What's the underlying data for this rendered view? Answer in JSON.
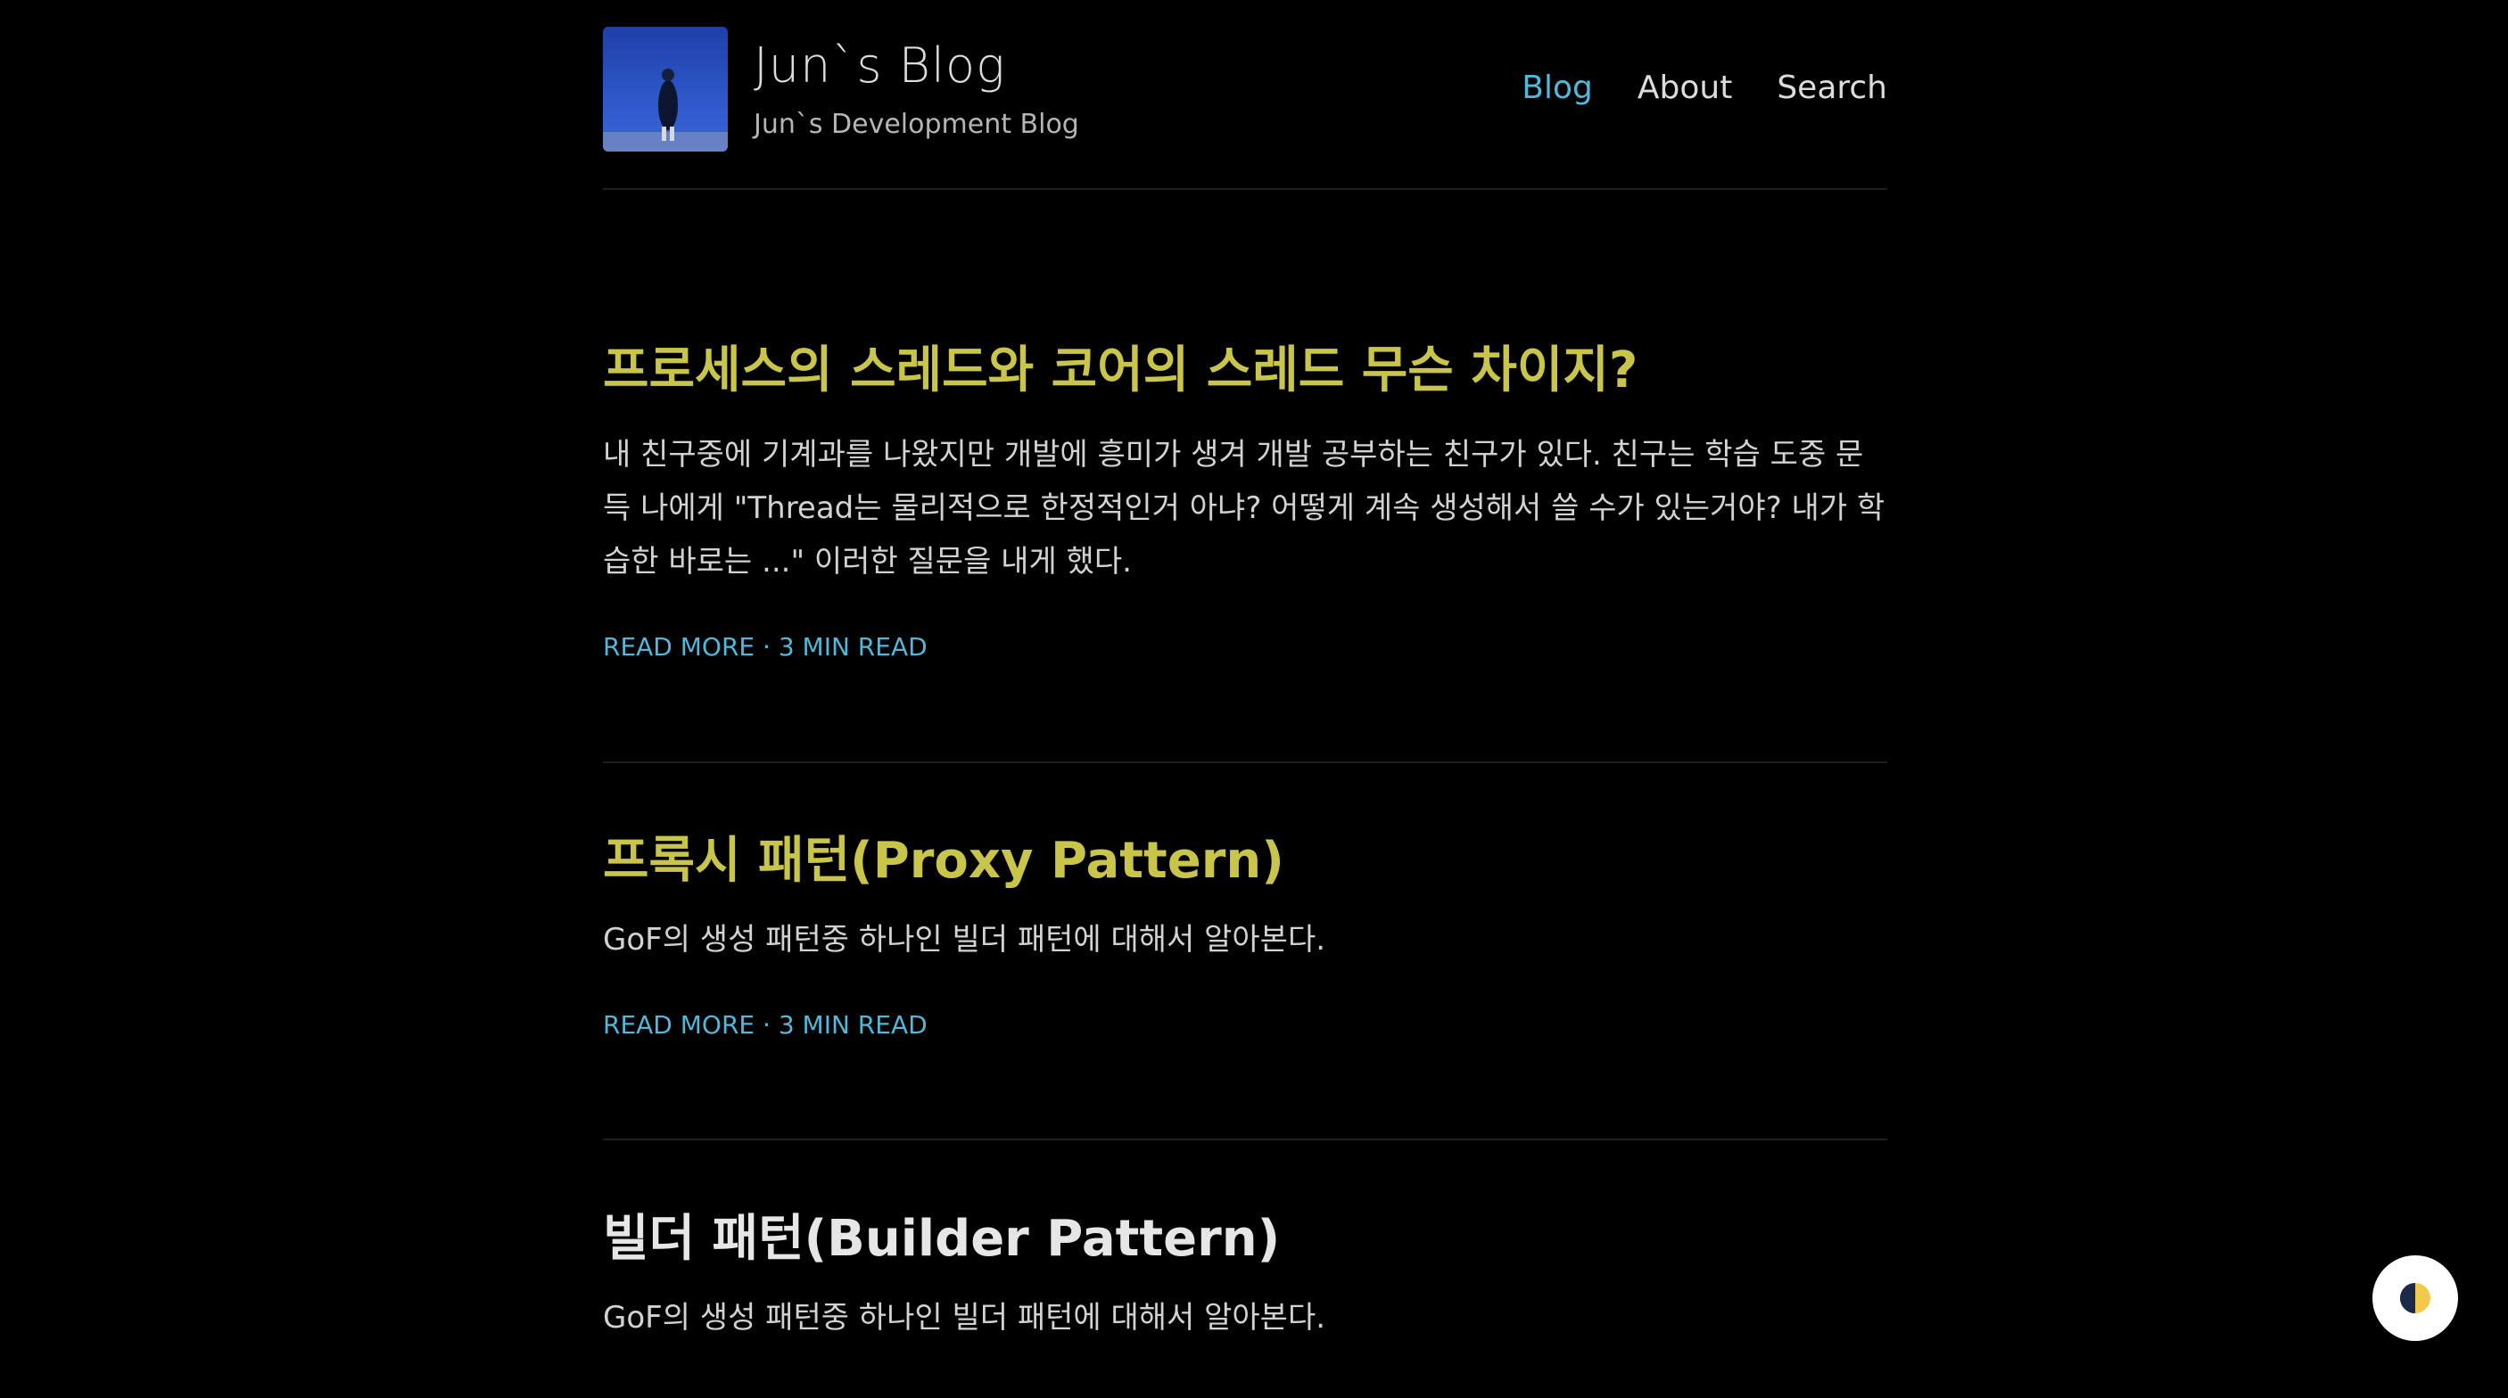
{
  "header": {
    "site_title": "Jun`s Blog",
    "site_subtitle": "Jun`s Development Blog",
    "nav": [
      {
        "label": "Blog",
        "active": true
      },
      {
        "label": "About",
        "active": false
      },
      {
        "label": "Search",
        "active": false
      }
    ]
  },
  "posts": [
    {
      "title": "프로세스의 스레드와 코어의 스레드 무슨 차이지?",
      "title_color": "#c9c54a",
      "excerpt": "내 친구중에 기계과를 나왔지만 개발에 흥미가 생겨 개발 공부하는 친구가 있다. 친구는 학습 도중 문득 나에게 \"Thread는 물리적으로 한정적인거 아냐? 어떻게 계속 생성해서 쓸 수가 있는거야? 내가 학습한 바로는 ...\" 이러한 질문을 내게 했다.",
      "read_more": "READ MORE",
      "separator": "·",
      "read_time": "3 MIN READ"
    },
    {
      "title": "프록시 패턴(Proxy Pattern)",
      "title_color": "#c9c54a",
      "excerpt": "GoF의 생성 패턴중 하나인 빌더 패턴에 대해서 알아본다.",
      "read_more": "READ MORE",
      "separator": "·",
      "read_time": "3 MIN READ"
    },
    {
      "title": "빌더 패턴(Builder Pattern)",
      "title_color": "#e6e6e6",
      "excerpt": "GoF의 생성 패턴중 하나인 빌더 패턴에 대해서 알아본다."
    }
  ],
  "theme_toggle": {
    "icon": "half-moon-icon"
  },
  "colors": {
    "background": "#000000",
    "accent": "#52b7d8",
    "visited_title": "#c9c54a"
  }
}
